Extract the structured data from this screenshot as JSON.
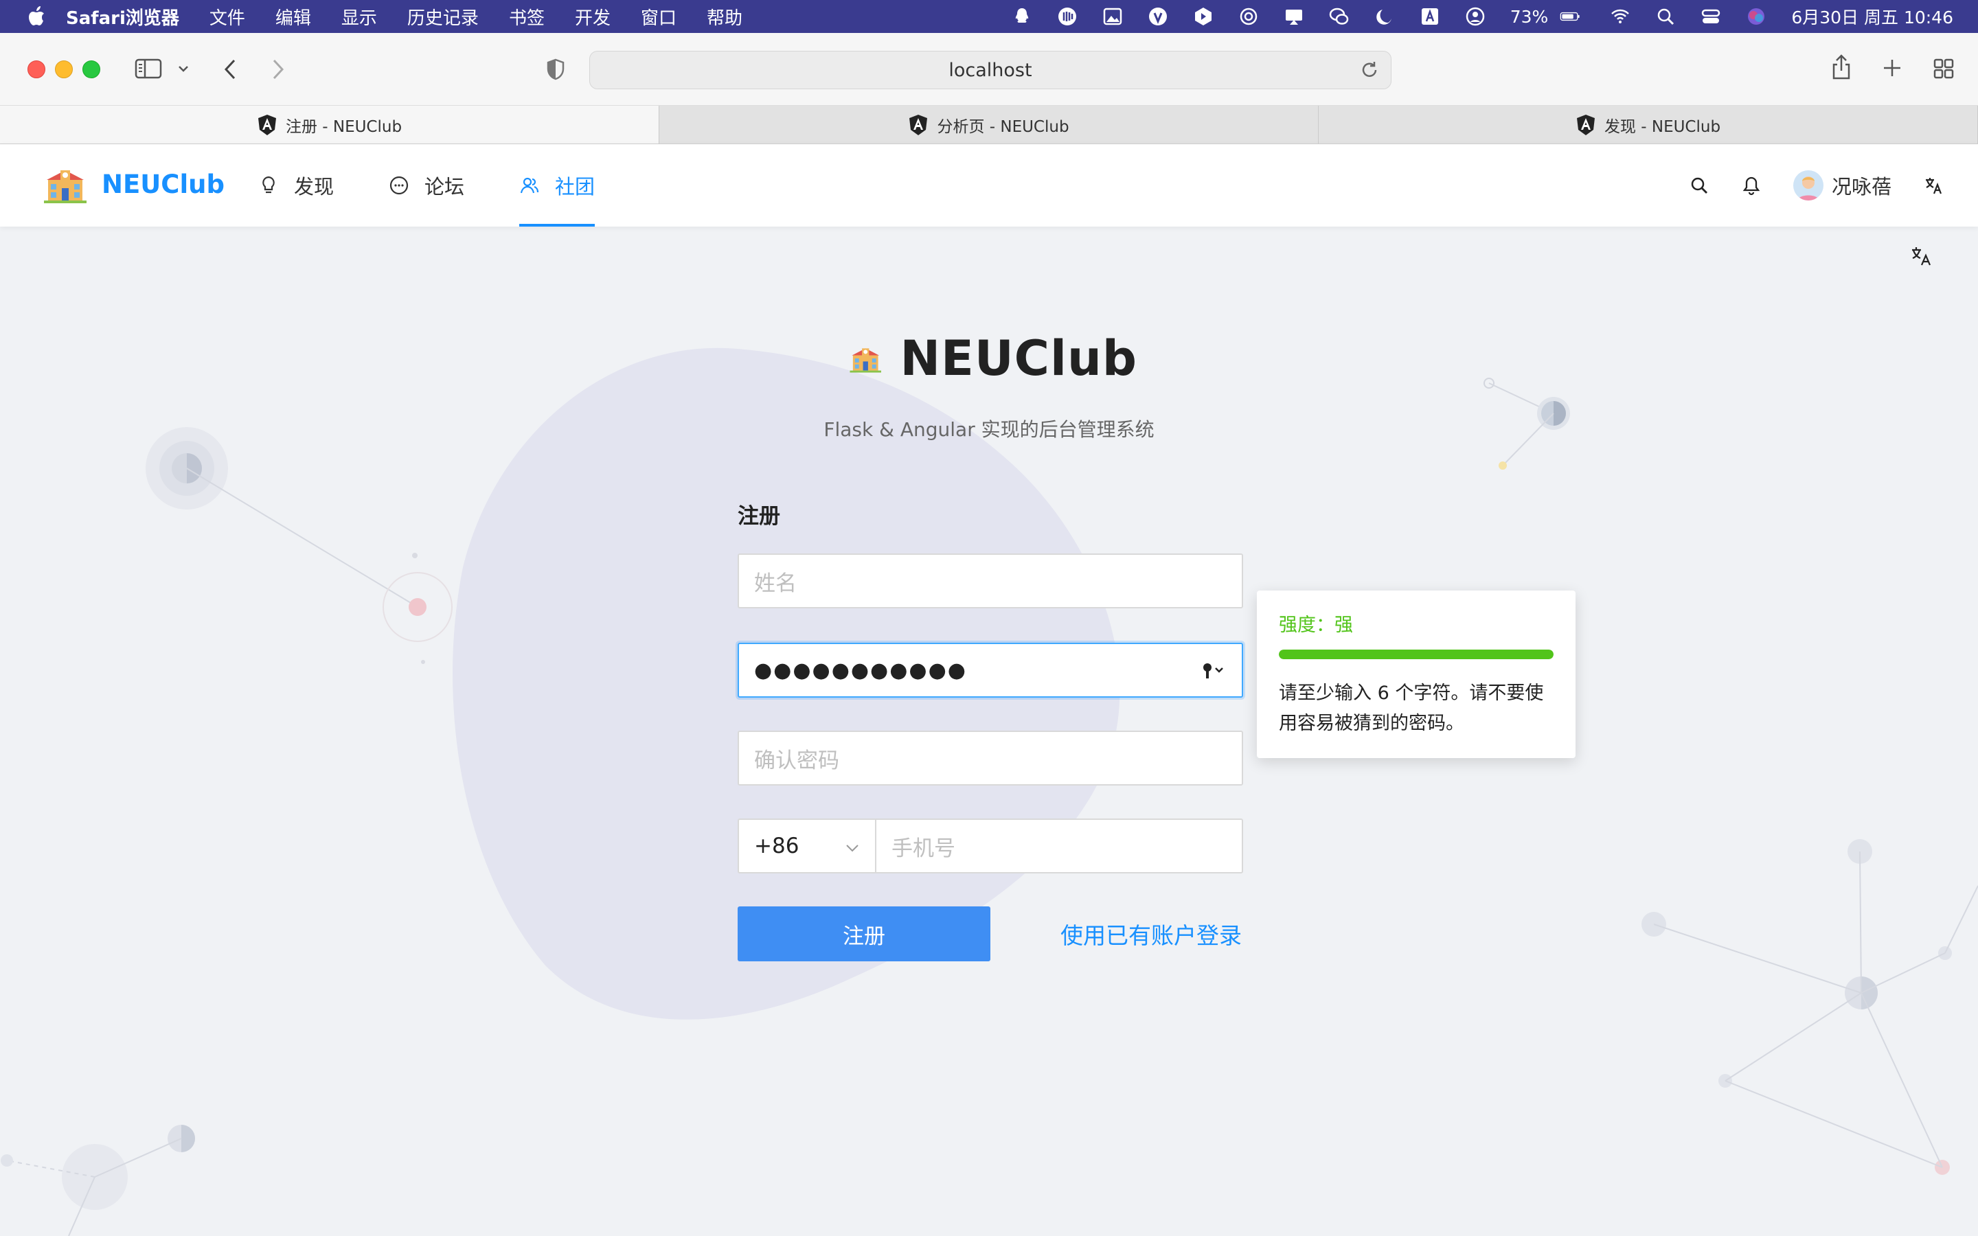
{
  "menubar": {
    "app_name": "Safari浏览器",
    "items": [
      "文件",
      "编辑",
      "显示",
      "历史记录",
      "书签",
      "开发",
      "窗口",
      "帮助"
    ],
    "battery": "73%",
    "datetime": "6月30日 周五 10:46",
    "status_icons": [
      "qq-icon",
      "music-icon",
      "photo-icon",
      "vpn-icon",
      "app-icon",
      "sync-icon",
      "screen-mirror-icon",
      "wechat-icon",
      "moon-icon",
      "input-method-icon",
      "user-icon",
      "battery-icon",
      "wifi-icon",
      "spotlight-icon",
      "control-center-icon",
      "siri-icon"
    ]
  },
  "browser": {
    "url": "localhost",
    "tabs": [
      {
        "label": "注册 - NEUClub",
        "active": true
      },
      {
        "label": "分析页 - NEUClub",
        "active": false
      },
      {
        "label": "发现 - NEUClub",
        "active": false
      }
    ]
  },
  "header": {
    "brand": "NEUClub",
    "nav": [
      {
        "label": "发现",
        "icon": "bulb-icon",
        "active": false
      },
      {
        "label": "论坛",
        "icon": "message-icon",
        "active": false
      },
      {
        "label": "社团",
        "icon": "team-icon",
        "active": true
      }
    ],
    "user_name": "况咏蓓"
  },
  "page": {
    "title": "NEUClub",
    "subtitle": "Flask & Angular 实现的后台管理系统",
    "form": {
      "heading": "注册",
      "name_placeholder": "姓名",
      "password_value": "●●●●●●●●●●●",
      "confirm_placeholder": "确认密码",
      "country_code": "+86",
      "phone_placeholder": "手机号",
      "submit_label": "注册",
      "login_link": "使用已有账户登录"
    },
    "password_popover": {
      "strength_text": "强度：强",
      "strength_fraction": 1.0,
      "hint": "请至少输入 6 个字符。请不要使用容易被猜到的密码。"
    }
  },
  "colors": {
    "primary": "#1890ff",
    "button": "#3f8ef3",
    "strong": "#52c41a",
    "menubar": "#3a3b8f"
  }
}
